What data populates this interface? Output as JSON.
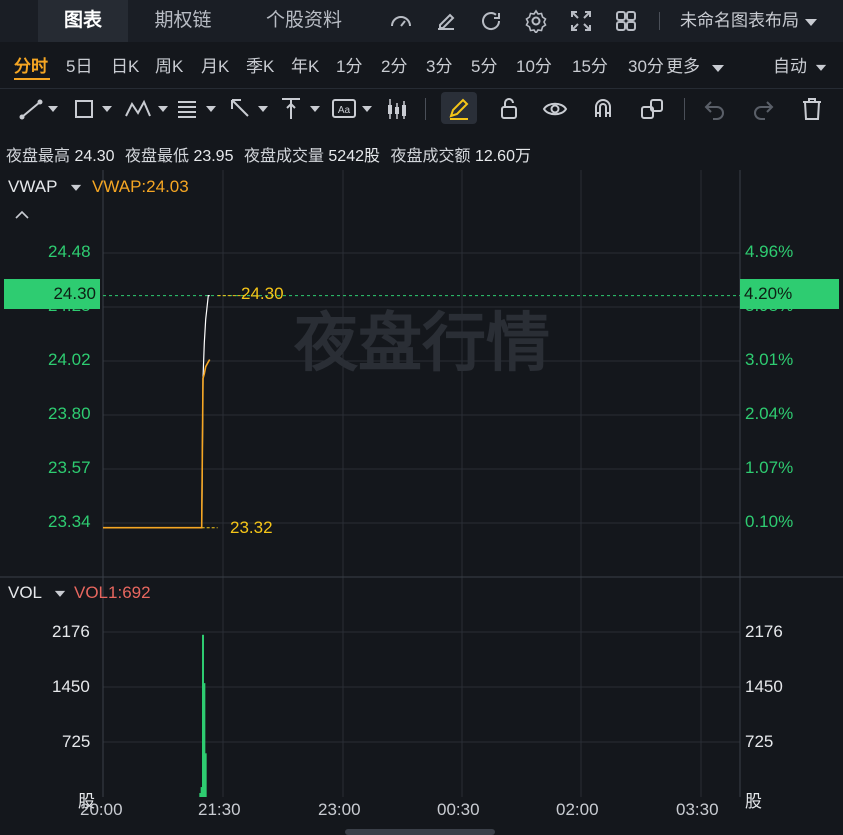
{
  "top_tabs": [
    "图表",
    "期权链",
    "个股资料"
  ],
  "layout_name": "未命名图表布局",
  "periods": [
    "分时",
    "5日",
    "日K",
    "周K",
    "月K",
    "季K",
    "年K",
    "1分",
    "2分",
    "3分",
    "5分",
    "10分",
    "15分",
    "30分",
    "更多"
  ],
  "auto_label": "自动",
  "info": {
    "high_label": "夜盘最高",
    "high": "24.30",
    "low_label": "夜盘最低",
    "low": "23.95",
    "vol_label": "夜盘成交量",
    "vol": "5242股",
    "amt_label": "夜盘成交额",
    "amt": "12.60万"
  },
  "price_panel": {
    "indicator": "VWAP",
    "indicator_value": "VWAP:24.03",
    "watermark": "夜盘行情",
    "left_ticks": [
      "24.48",
      "24.25",
      "24.02",
      "23.80",
      "23.57",
      "23.34"
    ],
    "right_ticks": [
      "4.96%",
      "3.98%",
      "3.01%",
      "2.04%",
      "1.07%",
      "0.10%"
    ],
    "last_price_tag": "24.30",
    "last_pct_tag": "4.20%",
    "high_marker": "24.30",
    "low_marker": "23.32"
  },
  "volume_panel": {
    "indicator": "VOL",
    "indicator_value": "VOL1:692",
    "ticks": [
      "2176",
      "1450",
      "725"
    ],
    "unit": "股"
  },
  "x_axis": [
    "20:00",
    "21:30",
    "23:00",
    "00:30",
    "02:00",
    "03:30"
  ],
  "chart_data": {
    "type": "line",
    "title": "",
    "xlabel": "",
    "ylabel": "",
    "ylim": [
      23.32,
      24.48
    ],
    "x": [
      "20:00",
      "21:14",
      "21:15",
      "21:16",
      "21:17",
      "21:18",
      "21:19",
      "21:20"
    ],
    "series": [
      {
        "name": "",
        "color": "#ffffff",
        "values": [
          23.32,
          23.32,
          23.95,
          24.1,
          24.2,
          24.25,
          24.3,
          24.3
        ]
      },
      {
        "name": "VWAP",
        "color": "#f5a623",
        "values": [
          23.32,
          23.32,
          23.95,
          23.97,
          24.0,
          24.01,
          24.02,
          24.03
        ]
      }
    ],
    "volume": {
      "ylim": [
        0,
        2900
      ],
      "bars": [
        {
          "x": "21:15",
          "value": 2450
        },
        {
          "x": "21:16",
          "value": 1720
        },
        {
          "x": "21:17",
          "value": 660
        },
        {
          "x": "21:13",
          "value": 60
        },
        {
          "x": "21:14",
          "value": 150
        }
      ]
    },
    "colors": {
      "up": "#2ecc71",
      "price_line": "#ffffff",
      "vwap": "#f5a623"
    }
  }
}
